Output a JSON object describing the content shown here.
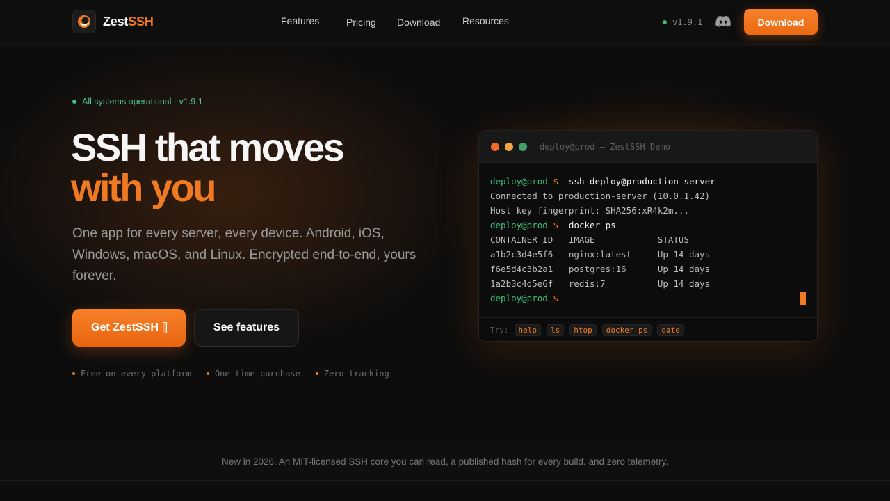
{
  "brand": {
    "name_part1": "Zest",
    "name_part2": "SSH"
  },
  "nav": {
    "links": [
      "Features",
      "Pricing",
      "Download",
      "Resources"
    ],
    "version": "v1.9.1",
    "cta": "Download"
  },
  "hero": {
    "status": "All systems operational · v1.9.1",
    "headline_line1": "SSH that moves",
    "headline_line2": "with you",
    "subtitle": "One app for every server, every device. Android, iOS, Windows, macOS, and Linux. Encrypted end-to-end, yours forever.",
    "primary_cta": "Get ZestSSH",
    "secondary_cta": "See features",
    "perks": [
      "Free on every platform",
      "One-time purchase",
      "Zero tracking"
    ]
  },
  "terminal": {
    "title": "deploy@prod — ZestSSH Demo",
    "prompt_user": "deploy@prod",
    "prompt_symbol": "$",
    "cmd1": "ssh deploy@production-server",
    "out1": "Connected to production-server (10.0.1.42)",
    "out2": "Host key fingerprint: SHA256:xR4k2m...",
    "cmd2": "docker ps",
    "table_header": "CONTAINER ID   IMAGE            STATUS",
    "rows": [
      "a1b2c3d4e5f6   nginx:latest     Up 14 days",
      "f6e5d4c3b2a1   postgres:16      Up 14 days",
      "1a2b3c4d5e6f   redis:7          Up 14 days"
    ],
    "try_label": "Try:",
    "suggestions": [
      "help",
      "ls",
      "htop",
      "docker ps",
      "date"
    ]
  },
  "banner": "New in 2026. An MIT-licensed SSH core you can read, a published hash for every build, and zero telemetry.",
  "colors": {
    "accent": "#f07a22",
    "success": "#3fbf7a",
    "background": "#0d0d0d"
  }
}
